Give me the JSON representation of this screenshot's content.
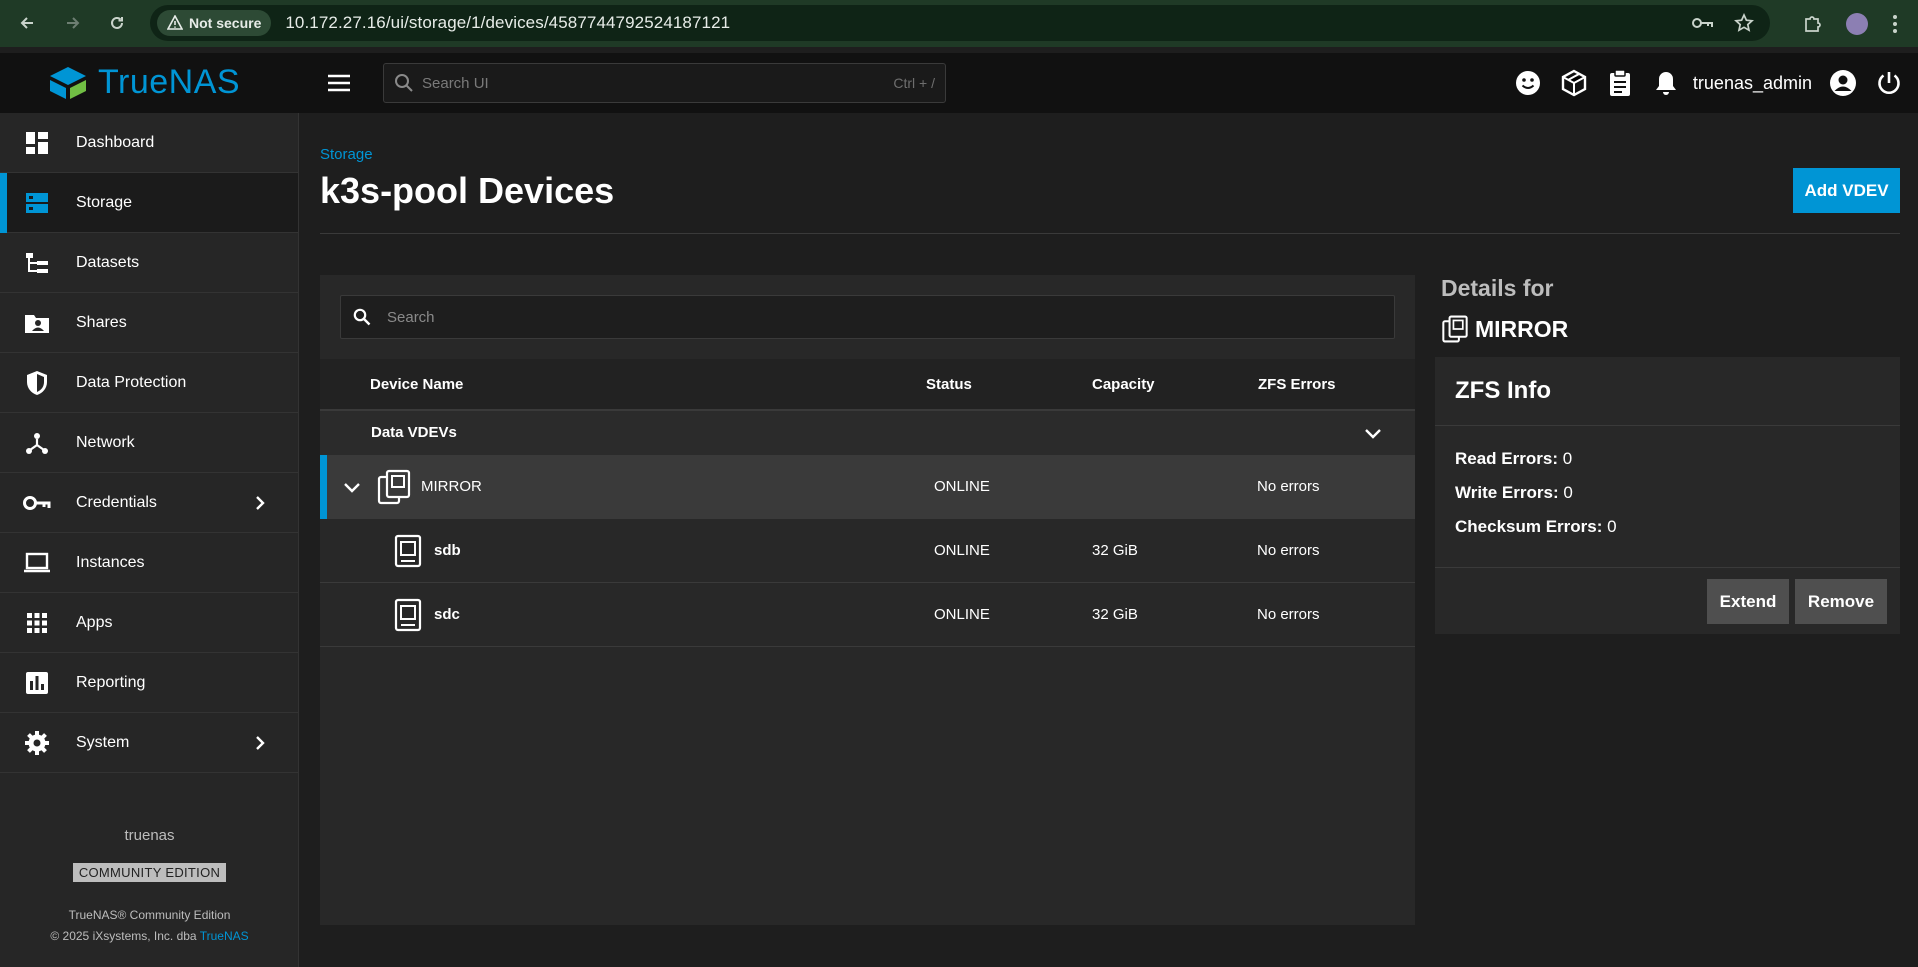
{
  "browser": {
    "security_label": "Not secure",
    "url": "10.172.27.16/ui/storage/1/devices/4587744792524187121"
  },
  "topbar": {
    "brand": "TrueNAS",
    "search_placeholder": "Search UI",
    "search_shortcut": "Ctrl + /",
    "username": "truenas_admin"
  },
  "sidebar": {
    "items": [
      {
        "label": "Dashboard",
        "icon": "dashboard-icon"
      },
      {
        "label": "Storage",
        "icon": "storage-icon",
        "active": true
      },
      {
        "label": "Datasets",
        "icon": "datasets-icon"
      },
      {
        "label": "Shares",
        "icon": "shares-icon"
      },
      {
        "label": "Data Protection",
        "icon": "shield-icon"
      },
      {
        "label": "Network",
        "icon": "network-icon"
      },
      {
        "label": "Credentials",
        "icon": "key-icon",
        "expandable": true
      },
      {
        "label": "Instances",
        "icon": "laptop-icon"
      },
      {
        "label": "Apps",
        "icon": "apps-grid-icon"
      },
      {
        "label": "Reporting",
        "icon": "reporting-icon"
      },
      {
        "label": "System",
        "icon": "gear-icon",
        "expandable": true
      }
    ],
    "hostname": "truenas",
    "edition_badge": "COMMUNITY EDITION",
    "copyright_line1": "TrueNAS® Community Edition",
    "copyright_line2_prefix": "© 2025 iXsystems, Inc. dba ",
    "copyright_line2_link": "TrueNAS"
  },
  "page": {
    "breadcrumb": "Storage",
    "title": "k3s-pool Devices",
    "add_vdev_label": "Add VDEV"
  },
  "devices_table": {
    "search_placeholder": "Search",
    "columns": [
      "Device Name",
      "Status",
      "Capacity",
      "ZFS Errors"
    ],
    "group_label": "Data VDEVs",
    "rows": [
      {
        "name": "MIRROR",
        "status": "ONLINE",
        "capacity": "",
        "errors": "No errors"
      },
      {
        "name": "sdb",
        "status": "ONLINE",
        "capacity": "32 GiB",
        "errors": "No errors"
      },
      {
        "name": "sdc",
        "status": "ONLINE",
        "capacity": "32 GiB",
        "errors": "No errors"
      }
    ]
  },
  "details": {
    "heading": "Details for",
    "device_name": "MIRROR",
    "zfs_info_title": "ZFS Info",
    "read_errors_label": "Read Errors:",
    "read_errors_value": "0",
    "write_errors_label": "Write Errors:",
    "write_errors_value": "0",
    "checksum_errors_label": "Checksum Errors:",
    "checksum_errors_value": "0",
    "extend_label": "Extend",
    "remove_label": "Remove"
  },
  "colors": {
    "accent": "#0095d5",
    "sidebar_bg": "#262626",
    "topbar_bg": "#111111",
    "browser_bar_bg": "#1f3a26"
  }
}
